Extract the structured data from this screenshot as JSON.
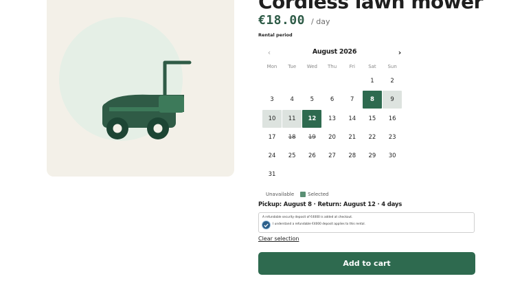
{
  "product": {
    "title": "Cordless lawn mower",
    "price": "€18.00",
    "price_unit": "/ day",
    "image_icon": "lawn-mower-illustration"
  },
  "rental": {
    "period_label": "Rental period",
    "calendar": {
      "month": "August 2026",
      "prev_icon": "chevron-left-icon",
      "next_icon": "chevron-right-icon",
      "weekdays": [
        "Mon",
        "Tue",
        "Wed",
        "Thu",
        "Fri",
        "Sat",
        "Sun"
      ],
      "leading_blanks": 5,
      "days": [
        {
          "day": "1",
          "state": "available"
        },
        {
          "day": "2",
          "state": "available"
        },
        {
          "day": "3",
          "state": "available"
        },
        {
          "day": "4",
          "state": "available"
        },
        {
          "day": "5",
          "state": "available"
        },
        {
          "day": "6",
          "state": "available"
        },
        {
          "day": "7",
          "state": "available"
        },
        {
          "day": "8",
          "state": "selected"
        },
        {
          "day": "9",
          "state": "range"
        },
        {
          "day": "10",
          "state": "range"
        },
        {
          "day": "11",
          "state": "range"
        },
        {
          "day": "12",
          "state": "selected"
        },
        {
          "day": "13",
          "state": "available"
        },
        {
          "day": "14",
          "state": "available"
        },
        {
          "day": "15",
          "state": "available"
        },
        {
          "day": "16",
          "state": "available"
        },
        {
          "day": "17",
          "state": "available"
        },
        {
          "day": "18",
          "state": "unavailable"
        },
        {
          "day": "19",
          "state": "unavailable"
        },
        {
          "day": "20",
          "state": "available"
        },
        {
          "day": "21",
          "state": "available"
        },
        {
          "day": "22",
          "state": "available"
        },
        {
          "day": "23",
          "state": "available"
        },
        {
          "day": "24",
          "state": "available"
        },
        {
          "day": "25",
          "state": "available"
        },
        {
          "day": "26",
          "state": "available"
        },
        {
          "day": "27",
          "state": "available"
        },
        {
          "day": "28",
          "state": "available"
        },
        {
          "day": "29",
          "state": "available"
        },
        {
          "day": "30",
          "state": "available"
        },
        {
          "day": "31",
          "state": "available"
        }
      ]
    },
    "legend": {
      "unavailable": "Unavailable",
      "selected": "Selected"
    },
    "summary": "Pickup: August 8 · Return: August 12 · 4 days",
    "deposit_note": "A refundable security deposit of €4000 is added at checkout.",
    "deposit_checkbox_label": "I understand a refundable €4000 deposit applies to this rental.",
    "deposit_checked": true,
    "clear_label": "Clear selection",
    "add_to_cart_label": "Add to cart"
  },
  "colors": {
    "accent": "#2e6a4f",
    "range": "#dde3df",
    "image_bg": "#f3f0e8"
  }
}
